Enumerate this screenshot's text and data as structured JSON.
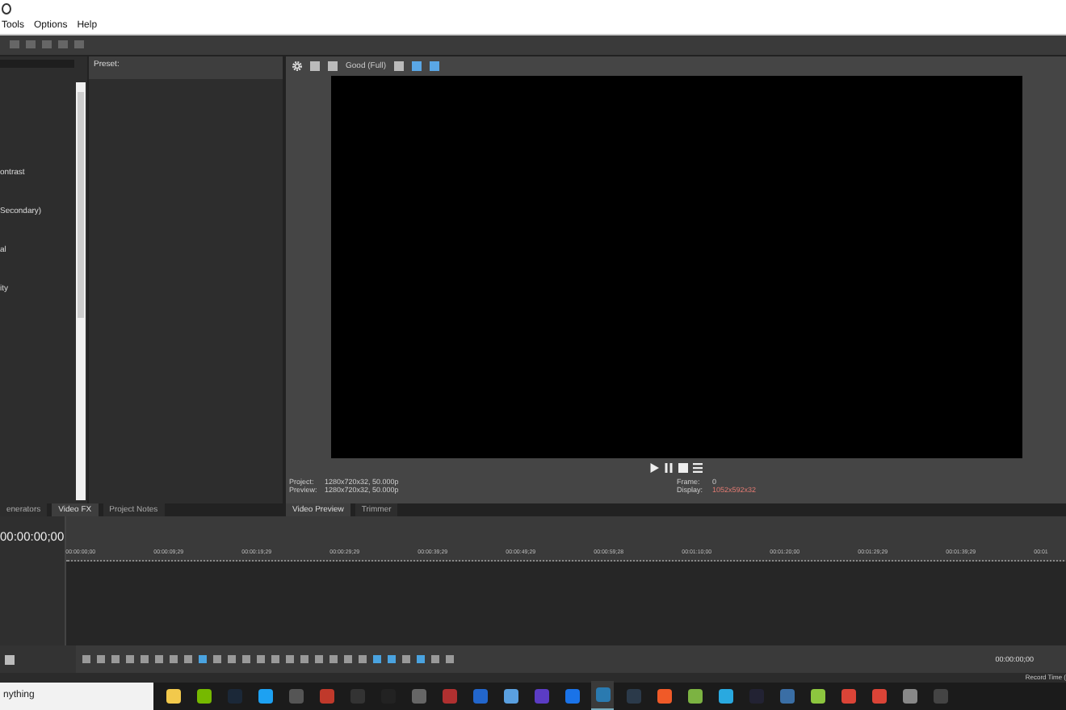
{
  "menu": [
    {
      "label": "Tools"
    },
    {
      "label": "Options"
    },
    {
      "label": "Help"
    }
  ],
  "fx_list": {
    "items": [
      {
        "label": "ontrast"
      },
      {
        "label": "Secondary)"
      },
      {
        "label": "al"
      },
      {
        "label": "ity"
      }
    ]
  },
  "presets": {
    "title": "Preset:"
  },
  "left_tabs": [
    {
      "label": "enerators",
      "selected": false
    },
    {
      "label": "Video FX",
      "selected": true
    },
    {
      "label": "Project Notes",
      "selected": false
    }
  ],
  "preview": {
    "quality": "Good (Full)",
    "info_left": [
      {
        "key": "Project:",
        "value": "1280x720x32, 50.000p"
      },
      {
        "key": "Preview:",
        "value": "1280x720x32, 50.000p"
      }
    ],
    "info_right": [
      {
        "key": "Frame:",
        "value": "0",
        "kind": "plain"
      },
      {
        "key": "Display:",
        "value": "1052x592x32",
        "kind": "alert"
      }
    ]
  },
  "preview_tabs": [
    {
      "label": "Video Preview",
      "selected": true
    },
    {
      "label": "Trimmer",
      "selected": false
    }
  ],
  "timeline": {
    "timecode": "00:00:00;00",
    "ruler": [
      "00:00:00;00",
      "00:00:09;29",
      "00:00:19;29",
      "00:00:29;29",
      "00:00:39;29",
      "00:00:49;29",
      "00:00:59;28",
      "00:01:10;00",
      "00:01:20;00",
      "00:01:29;29",
      "00:01:39;29",
      "00:01"
    ]
  },
  "transport": {
    "time": "00:00:00;00"
  },
  "status_bar": {
    "text": "Record Time ("
  },
  "taskbar": {
    "search": "nything"
  }
}
